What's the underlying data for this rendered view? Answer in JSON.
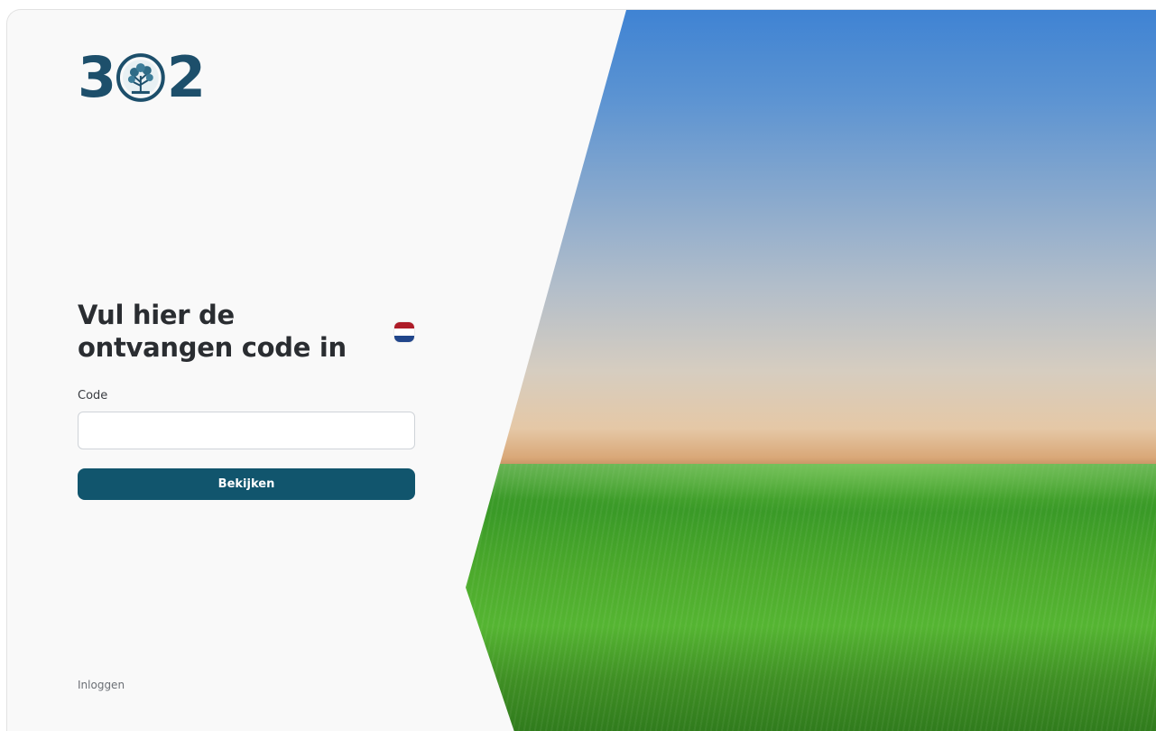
{
  "logo": {
    "digit_left": "3",
    "digit_right": "2",
    "emblem_icon": "tree-emblem-icon"
  },
  "heading": "Vul hier de ontvangen code in",
  "language": {
    "flag_icon": "netherlands-flag-icon",
    "colors": [
      "#ae1c28",
      "#ffffff",
      "#21468b"
    ]
  },
  "form": {
    "code_label": "Code",
    "code_value": "",
    "code_placeholder": "",
    "submit_label": "Bekijken"
  },
  "footer": {
    "login_link": "Inloggen"
  },
  "colors": {
    "brand": "#1d4f6b",
    "button": "#11556d",
    "panel_background": "#f9f9f9"
  }
}
